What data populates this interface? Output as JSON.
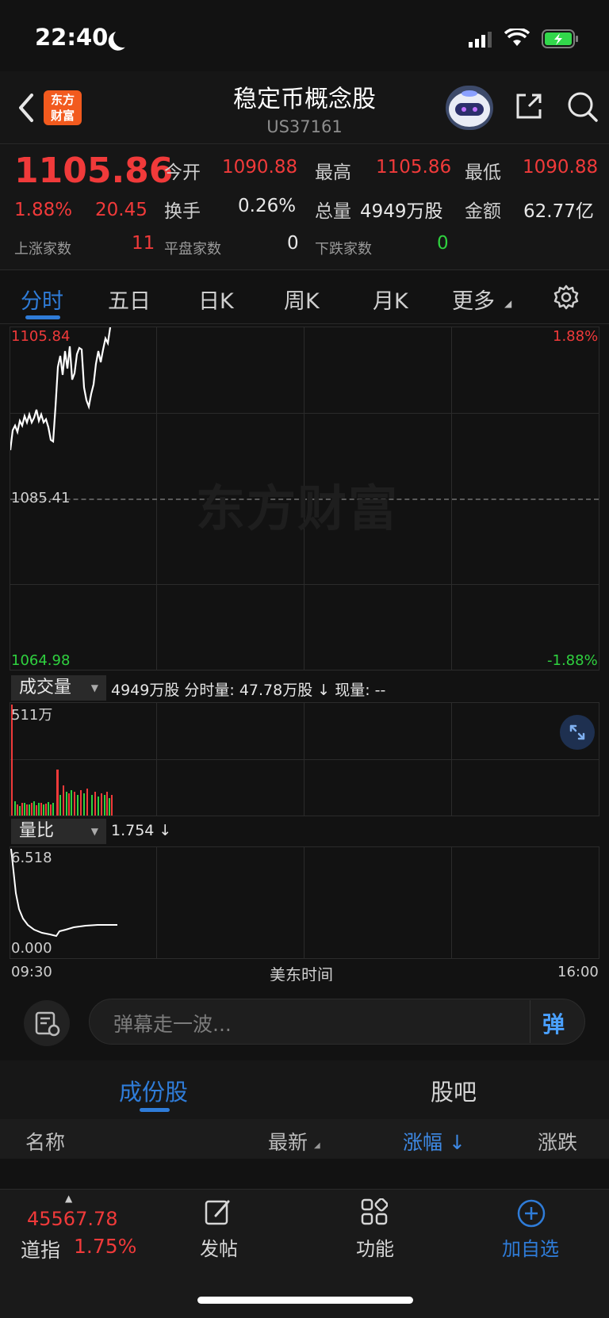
{
  "status_bar": {
    "time": "22:40"
  },
  "header": {
    "logo_text": "东方财富",
    "title": "稳定币概念股",
    "code": "US37161"
  },
  "quote": {
    "price": "1105.86",
    "change_pct": "1.88%",
    "change_amt": "20.45",
    "open_label": "今开",
    "open": "1090.88",
    "high_label": "最高",
    "high": "1105.86",
    "low_label": "最低",
    "low": "1090.88",
    "turnover_label": "换手",
    "turnover": "0.26%",
    "volume_label": "总量",
    "volume": "4949万股",
    "amount_label": "金额",
    "amount": "62.77亿",
    "up_label": "上涨家数",
    "up_count": "11",
    "flat_label": "平盘家数",
    "flat_count": "0",
    "down_label": "下跌家数",
    "down_count": "0"
  },
  "tabs": [
    "分时",
    "五日",
    "日K",
    "周K",
    "月K",
    "更多"
  ],
  "active_tab": 0,
  "chart": {
    "price_high": "1105.84",
    "price_mid": "1085.41",
    "price_low": "1064.98",
    "pct_high": "1.88%",
    "pct_low": "-1.88%",
    "watermark": "东方财富",
    "volume_dropdown": "成交量",
    "volume_info": "4949万股  分时量: 47.78万股 ↓ 现量: --",
    "volume_max": "511万",
    "ratio_dropdown": "量比",
    "ratio_info": "1.754 ↓",
    "ratio_max": "6.518",
    "ratio_min": "0.000",
    "time_start": "09:30",
    "time_label": "美东时间",
    "time_end": "16:00"
  },
  "danmu": {
    "placeholder": "弹幕走一波...",
    "send_label": "弹"
  },
  "lower_tabs": [
    "成份股",
    "股吧"
  ],
  "table_headers": {
    "name": "名称",
    "latest": "最新",
    "change_pct": "涨幅 ↓",
    "change": "涨跌"
  },
  "bottom_bar": {
    "index_value": "45567.78",
    "index_name": "道指",
    "index_pct": "1.75%",
    "post_label": "发帖",
    "function_label": "功能",
    "add_label": "加自选"
  },
  "colors": {
    "up": "#f03a3a",
    "down": "#2fd13f",
    "accent": "#2f7cd8",
    "background": "#121212"
  }
}
